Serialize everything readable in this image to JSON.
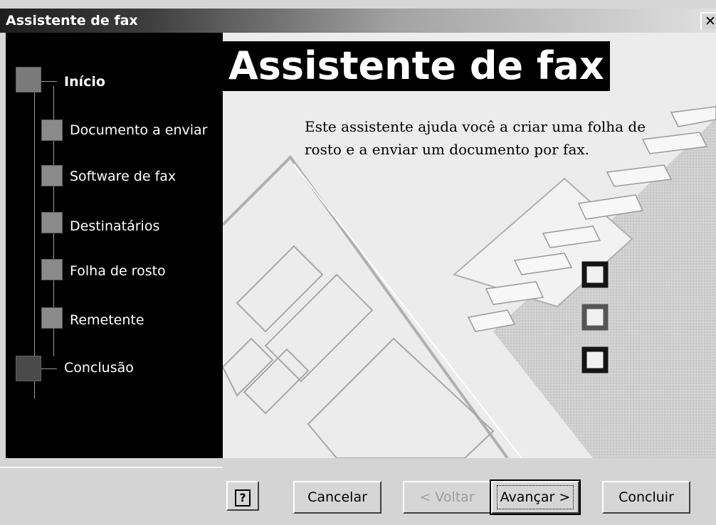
{
  "window": {
    "title": "Assistente de fax",
    "close": "✕"
  },
  "steps": [
    {
      "label": "Início",
      "bold": true
    },
    {
      "label": "Documento a enviar"
    },
    {
      "label": "Software de fax"
    },
    {
      "label": "Destinatários"
    },
    {
      "label": "Folha de rosto"
    },
    {
      "label": "Remetente"
    },
    {
      "label": "Conclusão"
    }
  ],
  "main": {
    "heading": "Assistente de fax",
    "description": "Este assistente ajuda você a criar uma folha de rosto e a enviar um documento por fax."
  },
  "buttons": {
    "help": "?",
    "cancel": "Cancelar",
    "back": "< Voltar",
    "next": "Avançar >",
    "finish": "Concluir"
  }
}
